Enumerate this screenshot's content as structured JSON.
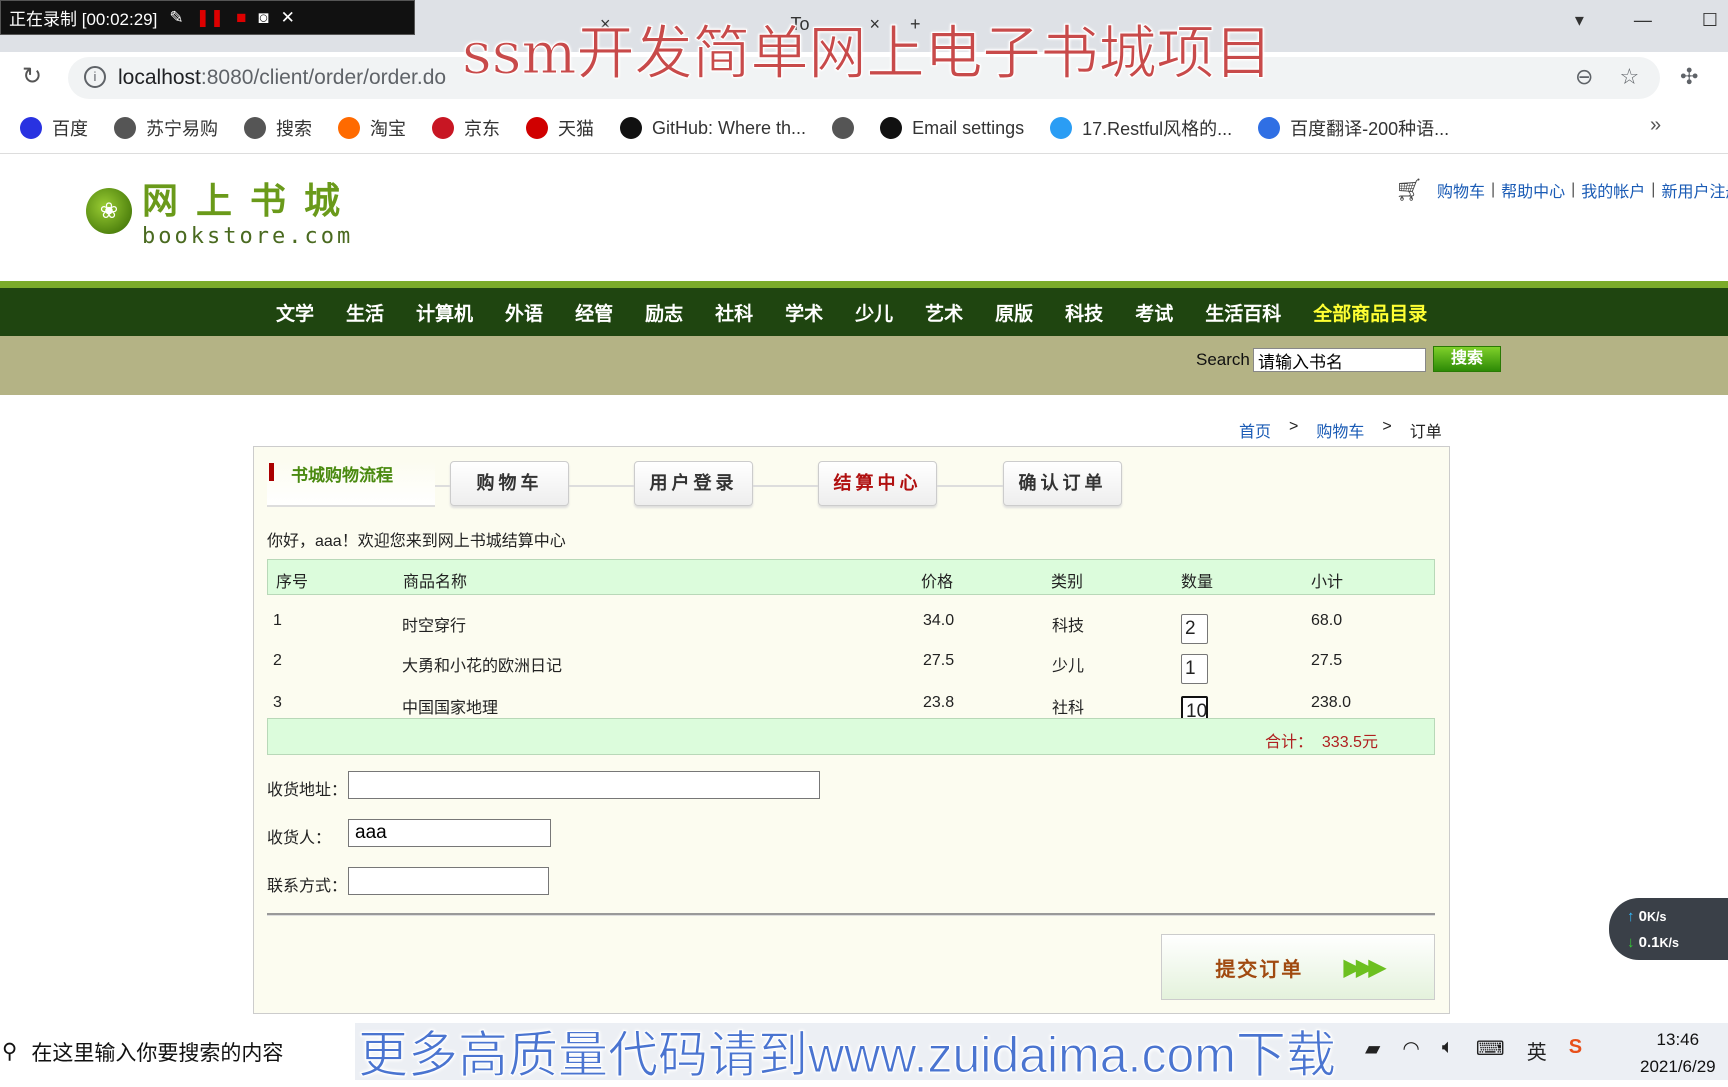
{
  "recorder": {
    "status": "正在录制 [00:02:29]"
  },
  "browser": {
    "tab_fragments": [
      "×",
      "To",
      "×",
      "+"
    ],
    "url_host": "localhost",
    "url_rest": ":8080/client/order/order.do",
    "bookmarks": [
      {
        "label": "百度",
        "icon": "baidu-icon",
        "color": "#2932e1"
      },
      {
        "label": "苏宁易购",
        "icon": "globe-icon",
        "color": "#555555"
      },
      {
        "label": "搜索",
        "icon": "globe-icon",
        "color": "#555555"
      },
      {
        "label": "淘宝",
        "icon": "taobao-icon",
        "color": "#ff6a00"
      },
      {
        "label": "京东",
        "icon": "jd-icon",
        "color": "#c81623"
      },
      {
        "label": "天猫",
        "icon": "tmall-icon",
        "color": "#d00000"
      },
      {
        "label": "GitHub: Where th...",
        "icon": "github-icon",
        "color": "#111111"
      },
      {
        "label": "",
        "icon": "globe-icon",
        "color": "#555555"
      },
      {
        "label": "Email settings",
        "icon": "github-icon",
        "color": "#111111"
      },
      {
        "label": "17.Restful风格的...",
        "icon": "diamond-icon",
        "color": "#2a9df4"
      },
      {
        "label": "百度翻译-200种语...",
        "icon": "translate-icon",
        "color": "#2f6fe4"
      }
    ],
    "more": "»"
  },
  "site": {
    "logo_cn": "网上书城",
    "logo_en": "bookstore.com",
    "top_links": [
      "购物车",
      "帮助中心",
      "我的帐户",
      "新用户注册"
    ],
    "nav": [
      "文学",
      "生活",
      "计算机",
      "外语",
      "经管",
      "励志",
      "社科",
      "学术",
      "少儿",
      "艺术",
      "原版",
      "科技",
      "考试",
      "生活百科",
      "全部商品目录"
    ],
    "search_label": "Search",
    "search_value": "请输入书名",
    "search_button": "搜索",
    "breadcrumb": [
      "首页",
      ">",
      "购物车",
      ">",
      "订单"
    ]
  },
  "checkout": {
    "flow_title": "书城购物流程",
    "steps": [
      "购物车",
      "用户登录",
      "结算中心",
      "确认订单"
    ],
    "active_step": "结算中心",
    "greeting": "你好，aaa！欢迎您来到网上书城结算中心",
    "columns": [
      "序号",
      "商品名称",
      "价格",
      "类别",
      "数量",
      "小计"
    ],
    "rows": [
      {
        "no": "1",
        "name": "时空穿行",
        "price": "34.0",
        "category": "科技",
        "qty": "2",
        "subtotal": "68.0"
      },
      {
        "no": "2",
        "name": "大勇和小花的欧洲日记",
        "price": "27.5",
        "category": "少儿",
        "qty": "1",
        "subtotal": "27.5"
      },
      {
        "no": "3",
        "name": "中国国家地理",
        "price": "23.8",
        "category": "社科",
        "qty": "10",
        "subtotal": "238.0"
      }
    ],
    "total_label": "合计：",
    "total_value": "333.5元",
    "address_label": "收货地址：",
    "address_value": "",
    "receiver_label": "收货人：",
    "receiver_value": "aaa",
    "phone_label": "联系方式：",
    "phone_value": "",
    "submit": "提交订单"
  },
  "network": {
    "up": "0",
    "down": "0.1",
    "unit": "K/s"
  },
  "taskbar": {
    "search_placeholder": "在这里输入你要搜索的内容",
    "ime": "英",
    "time": "13:46",
    "date": "2021/6/29"
  },
  "watermarks": {
    "top": "ssm开发简单网上电子书城项目",
    "bottom": "更多高质量代码请到www.zuidaima.com下载"
  }
}
